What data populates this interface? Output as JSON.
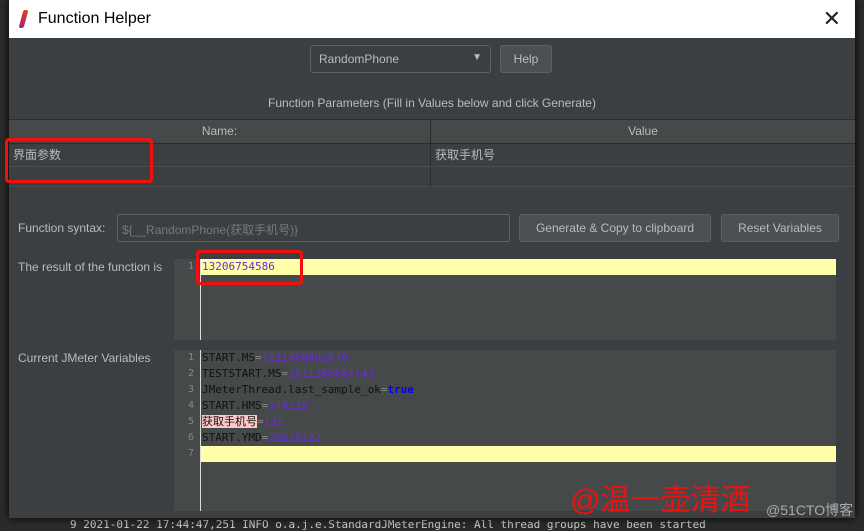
{
  "window": {
    "title": "Function Helper"
  },
  "function_select": {
    "value": "RandomPhone"
  },
  "help_button": "Help",
  "params": {
    "title": "Function Parameters (Fill in Values below and click Generate)",
    "columns": [
      "Name:",
      "Value"
    ],
    "rows": [
      {
        "name": "界面参数",
        "value": "获取手机号"
      }
    ]
  },
  "syntax": {
    "label": "Function syntax:",
    "value": "${__RandomPhone(获取手机号)}"
  },
  "generate_button": "Generate & Copy to clipboard",
  "reset_button": "Reset Variables",
  "result": {
    "label": "The result of the function is",
    "lines": [
      {
        "n": "1",
        "text": "13206754586"
      }
    ]
  },
  "variables": {
    "label": "Current JMeter Variables",
    "lines": [
      {
        "n": "1",
        "key": "START.MS",
        "value": "1611308492079"
      },
      {
        "n": "2",
        "key": "TESTSTART.MS",
        "value": "1611308687143"
      },
      {
        "n": "3",
        "key": "JMeterThread.last_sample_ok",
        "value": "true"
      },
      {
        "n": "4",
        "key": "START.HMS",
        "value": "174132"
      },
      {
        "n": "5",
        "key": "获取手机号",
        "value": "132"
      },
      {
        "n": "6",
        "key": "START.YMD",
        "value": "20210122"
      },
      {
        "n": "7",
        "key": "",
        "value": ""
      }
    ]
  },
  "watermark": "@温一壶清酒",
  "watermark2": "@51CTO博客",
  "log_line": "9 2021-01-22 17:44:47,251 INFO o.a.j.e.StandardJMeterEngine: All thread groups have been started",
  "colors": {
    "highlight": "#ffffaa",
    "annotation": "#f01010",
    "value": "#6a2bd8"
  }
}
